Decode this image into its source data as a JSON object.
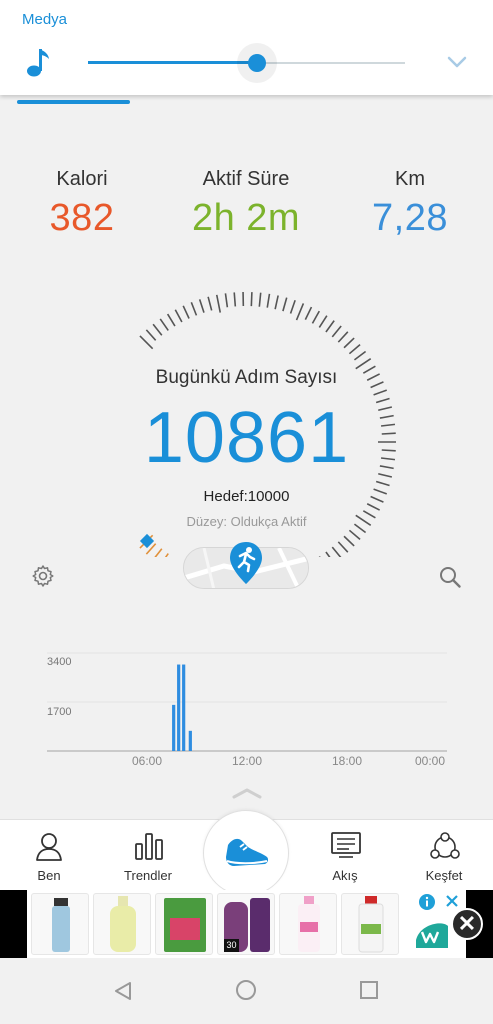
{
  "media": {
    "title": "Medya",
    "progress_fraction": 0.53,
    "accent_color": "#1a8fd8",
    "icons": [
      "music-note-icon",
      "chevron-down-icon"
    ]
  },
  "stats": {
    "calories": {
      "label": "Kalori",
      "value": "382",
      "color": "#e8582a"
    },
    "active_time": {
      "label": "Aktif Süre",
      "value": "2h 2m",
      "color": "#7cb32c"
    },
    "distance": {
      "label": "Km",
      "value": "7,28",
      "color": "#3a8fd9"
    }
  },
  "gauge": {
    "title": "Bugünkü Adım Sayısı",
    "steps": "10861",
    "goal": "Hedef:10000",
    "level": "Düzey: Oldukça Aktif",
    "progress_fraction": 1.0,
    "number_color": "#1a8fd8"
  },
  "chart_data": {
    "type": "bar",
    "ylim": [
      0,
      5100
    ],
    "yticks": [
      "3400",
      "1700"
    ],
    "xticks": [
      "06:00",
      "12:00",
      "18:00",
      "00:00"
    ],
    "x_hours": [
      7.6,
      7.9,
      8.2,
      8.6
    ],
    "values": [
      1600,
      3000,
      3000,
      700
    ],
    "bar_color": "#2f8de0"
  },
  "nav": {
    "items": [
      {
        "label": "Ben",
        "icon": "person-icon"
      },
      {
        "label": "Trendler",
        "icon": "bar-chart-icon"
      },
      {
        "label": "Akış",
        "icon": "feed-icon"
      },
      {
        "label": "Keşfet",
        "icon": "discover-icon"
      }
    ],
    "center_icon": "shoe-icon"
  },
  "ad": {
    "badge": "30",
    "close": "✕"
  },
  "system_nav": {
    "icons": [
      "back-icon",
      "home-icon",
      "recents-icon"
    ]
  }
}
